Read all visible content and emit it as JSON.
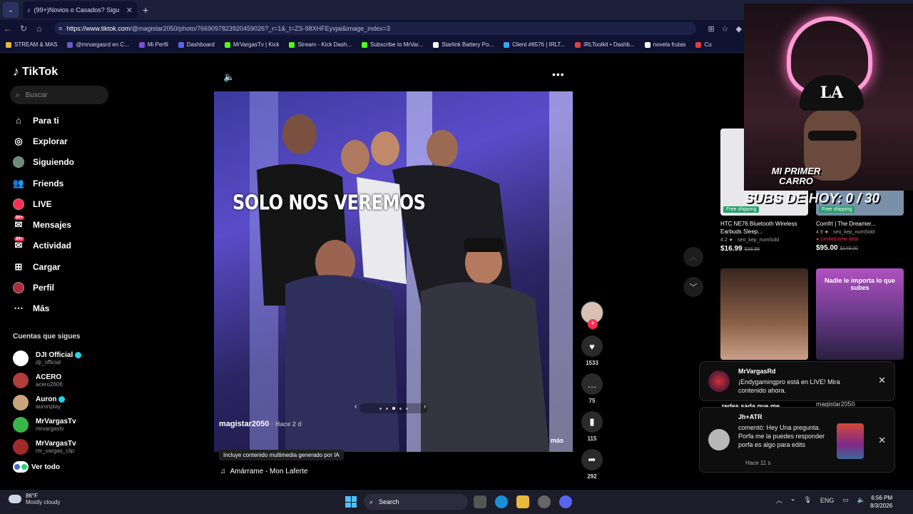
{
  "browser": {
    "tab_title": "(99+)Novios o Casados? Sigu",
    "url_host": "https://www.tiktok.com",
    "url_path": "/@magistar2050/photo/7669097823920459026?_r=1&_t=ZS-98XHFEyvjai&image_index=3",
    "bookmarks": [
      "STREAM & MAS",
      "@mrvargasrd en C...",
      "Mi Perfil",
      "Dashboard",
      "MrVargasTv | Kick",
      "Stream - Kick Dash...",
      "Subscribe to MrVar...",
      "Starlink Battery Po...",
      "Client #6576 | IRLT...",
      "IRLToolkit • Dashb...",
      "novela frutas",
      "Cu"
    ]
  },
  "sidebar": {
    "logo": "TikTok",
    "search_placeholder": "Buscar",
    "menu": [
      {
        "label": "Para ti",
        "icon": "home-icon"
      },
      {
        "label": "Explorar",
        "icon": "compass-icon"
      },
      {
        "label": "Siguiendo",
        "icon": "following-avatar-icon"
      },
      {
        "label": "Friends",
        "icon": "friends-icon"
      },
      {
        "label": "LIVE",
        "icon": "live-icon"
      },
      {
        "label": "Mensajes",
        "icon": "messages-icon",
        "badge": "99+"
      },
      {
        "label": "Actividad",
        "icon": "activity-icon",
        "badge": "99+"
      },
      {
        "label": "Cargar",
        "icon": "upload-icon"
      },
      {
        "label": "Perfil",
        "icon": "profile-icon"
      },
      {
        "label": "Más",
        "icon": "more-icon"
      }
    ],
    "following_heading": "Cuentas que sigues",
    "following": [
      {
        "name": "DJI Official",
        "handle": "dji_official",
        "verified": true,
        "color": "#ffffff"
      },
      {
        "name": "ACERO",
        "handle": "acero2606",
        "verified": false,
        "color": "#b23b3b"
      },
      {
        "name": "Auron",
        "handle": "auronplay",
        "verified": true,
        "color": "#c9a67a"
      },
      {
        "name": "MrVargasTv",
        "handle": "mrvargastv",
        "verified": false,
        "color": "#38b54a"
      },
      {
        "name": "MrVargasTv",
        "handle": "mr_vargas_clip",
        "verified": false,
        "color": "#a02a2a"
      }
    ],
    "see_all": "Ver todo"
  },
  "post": {
    "overlay_text": "SOLO NOS VEREMOS",
    "author": "magistar2050",
    "time": "· Hace 2 d",
    "more": "más",
    "ai_label": "Incluye contenido multimedia generado por IA",
    "music": "Amárrame - Mon Laferte",
    "image_index": 3,
    "image_count": 5
  },
  "actions": {
    "likes": "1533",
    "comments": "75",
    "saves": "115",
    "shares": "292"
  },
  "right": {
    "products": [
      {
        "title": "HTC NE76 Bluetooth Wireless Earbuds Sleep...",
        "rating": "4.2 ★ · seo_kep_numSold",
        "price": "$16.99",
        "old_price": "$38.99",
        "free": "Free shipping",
        "deal": ""
      },
      {
        "title": "Comfrt | The Dreamer...",
        "rating": "4.9 ★ · seo_kep_numSold",
        "price": "$95.00",
        "old_price": "$149.00",
        "free": "Free shipping",
        "deal": "Limited time deal"
      }
    ],
    "video_caption": "Nadie le importa lo que subes",
    "partial_caption_1": "redes sada que me",
    "partial_caption_2": "magistar2050"
  },
  "stream_overlay": {
    "title": "MI PRIMER CARRO",
    "subs": "SUBS DE HOY: 0 / 30",
    "cap_logo": "LA"
  },
  "notifications": [
    {
      "name": "MrVargasRd",
      "body": "¡Endygamingpro está en LIVE! Mira contenido ahora.",
      "time": ""
    },
    {
      "name": "Jh+ATR",
      "body": "comentó: Hey Una pregunta. Porfa me la puedes responder porfa es algo para edits",
      "time": "Hace 11 s"
    }
  ],
  "taskbar": {
    "temp": "86°F",
    "weather": "Mostly cloudy",
    "search": "Search",
    "lang": "ENG",
    "time": "6:56 PM",
    "date": "8/3/2026"
  }
}
